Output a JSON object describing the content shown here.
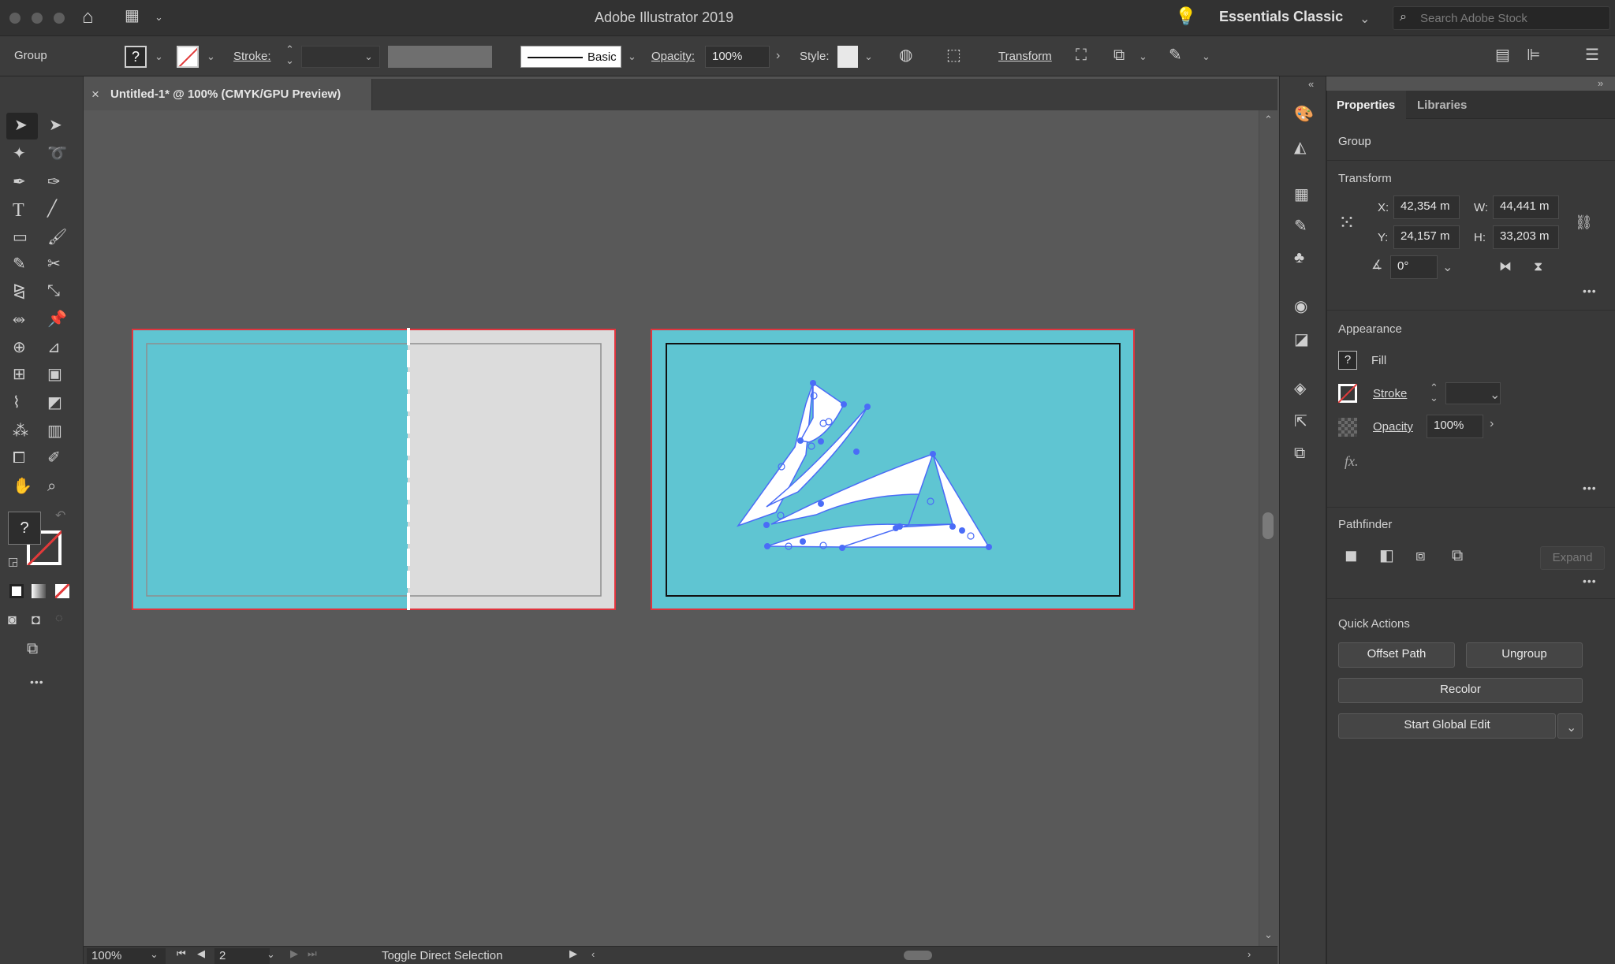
{
  "app": {
    "title": "Adobe Illustrator 2019",
    "workspace": "Essentials Classic",
    "search_placeholder": "Search Adobe Stock"
  },
  "control_bar": {
    "selection_type": "Group",
    "fill_unknown": "?",
    "stroke_label": "Stroke:",
    "brush_label": "Basic",
    "opacity_label": "Opacity:",
    "opacity_value": "100%",
    "style_label": "Style:",
    "transform_label": "Transform"
  },
  "document_tab": {
    "close": "×",
    "title": "Untitled-1* @ 100% (CMYK/GPU Preview)"
  },
  "toolbar": {
    "unknown_fill": "?",
    "more": "•••"
  },
  "status_bar": {
    "zoom": "100%",
    "artboard_number": "2",
    "tool_status": "Toggle Direct Selection"
  },
  "panel": {
    "tabs": [
      "Properties",
      "Libraries"
    ],
    "selection_type": "Group",
    "transform": {
      "title": "Transform",
      "x_label": "X:",
      "x_value": "42,354 m",
      "y_label": "Y:",
      "y_value": "24,157 m",
      "w_label": "W:",
      "w_value": "44,441 m",
      "h_label": "H:",
      "h_value": "33,203 m",
      "angle_value": "0°"
    },
    "appearance": {
      "title": "Appearance",
      "fill_unknown": "?",
      "fill_label": "Fill",
      "stroke_label": "Stroke",
      "opacity_label": "Opacity",
      "opacity_value": "100%",
      "fx_label": "fx."
    },
    "pathfinder": {
      "title": "Pathfinder",
      "expand_label": "Expand"
    },
    "quick_actions": {
      "title": "Quick Actions",
      "offset_path": "Offset Path",
      "ungroup": "Ungroup",
      "recolor": "Recolor",
      "start_global_edit": "Start Global Edit"
    },
    "more": "•••"
  },
  "colors": {
    "artboard_fill": "#5fc5d2",
    "artboard_border": "#e0343d",
    "selection_blue": "#4a6cf7",
    "panel_bg": "#393939"
  }
}
